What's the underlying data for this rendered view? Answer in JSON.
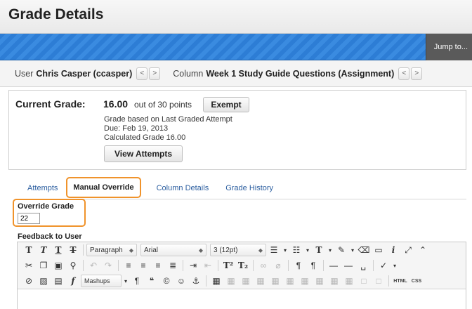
{
  "page": {
    "title": "Grade Details"
  },
  "header": {
    "jump_label": "Jump to..."
  },
  "navigation": {
    "user_label": "User",
    "user_value": "Chris Casper (ccasper)",
    "column_label": "Column",
    "column_value": "Week 1 Study Guide Questions (Assignment)",
    "prev_glyph": "<",
    "next_glyph": ">"
  },
  "current_grade": {
    "label": "Current Grade:",
    "score": "16.00",
    "out_of": "out of 30 points",
    "exempt_label": "Exempt",
    "based_on": "Grade based on Last Graded Attempt",
    "due": "Due: Feb 19, 2013",
    "calculated": "Calculated Grade  16.00",
    "view_attempts_label": "View Attempts"
  },
  "tabs": [
    {
      "label": "Attempts"
    },
    {
      "label": "Manual Override",
      "active": true
    },
    {
      "label": "Column Details"
    },
    {
      "label": "Grade History"
    }
  ],
  "override": {
    "label": "Override Grade",
    "value": "22"
  },
  "feedback": {
    "label": "Feedback to User",
    "paragraph_select": "Paragraph",
    "font_select": "Arial",
    "size_select": "3 (12pt)",
    "mashups_label": "Mashups",
    "html_label": "HTML",
    "css_label": "CSS"
  },
  "colors": {
    "accent_orange": "#f0932b",
    "link_blue": "#2a5d9f",
    "bar_blue": "#2d7dd5"
  }
}
